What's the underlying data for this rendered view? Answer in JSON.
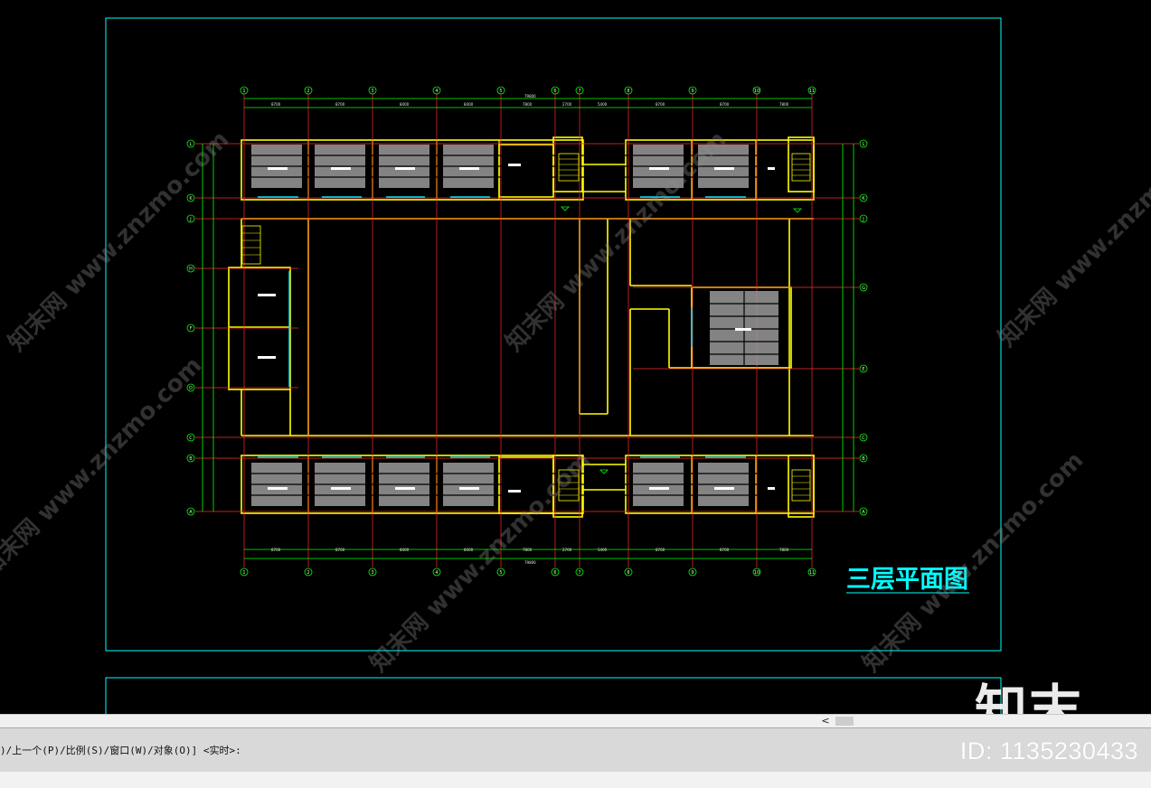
{
  "drawing": {
    "title": "三层平面图",
    "grid_top": [
      "1",
      "2",
      "3",
      "4",
      "5",
      "6",
      "7",
      "8",
      "9",
      "10",
      "11"
    ],
    "grid_left": [
      "L",
      "K",
      "J",
      "H",
      "F",
      "D",
      "C",
      "B",
      "A"
    ],
    "grid_right": [
      "L",
      "K",
      "J",
      "G",
      "E",
      "C",
      "B",
      "A"
    ],
    "colors": {
      "frame": "#00ffff",
      "walls": "#ffff00",
      "axes": "#ff2a2a",
      "dims": "#00ff00",
      "fixtures": "#e0e0e0",
      "title": "#00ffff"
    }
  },
  "watermark": {
    "site_text": "知末网 www.znzmo.com",
    "logo_text": "知末",
    "id_text": "ID: 1135230433"
  },
  "scrollbar": {
    "left_arrow": "<"
  },
  "command_line": {
    "prompt": ")/上一个(P)/比例(S)/窗口(W)/对象(O)] <实时>:"
  }
}
